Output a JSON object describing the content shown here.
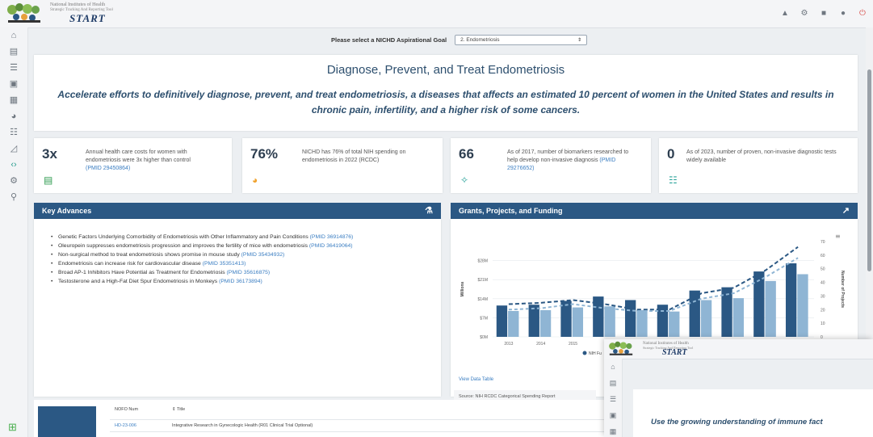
{
  "header": {
    "org_line1": "National Institutes of Health",
    "org_line2": "Strategic Tracking And Reporting Tool",
    "app_name": "START",
    "icons": [
      "megaphone-icon",
      "gear-icon",
      "chat-icon",
      "user-icon",
      "power-icon"
    ]
  },
  "sidebar": {
    "icons": [
      "home-icon",
      "document-icon",
      "list-icon",
      "briefcase-icon",
      "report-icon",
      "pie-chart-icon",
      "library-icon",
      "org-chart-icon",
      "code-icon",
      "settings-icon",
      "search-icon"
    ],
    "active": "code-icon"
  },
  "goal_selector": {
    "label": "Please select a NICHD Aspirational Goal",
    "selected": "2. Endometriosis"
  },
  "hero": {
    "title": "Diagnose, Prevent, and Treat Endometriosis",
    "text": "Accelerate efforts to definitively diagnose, prevent, and treat endometriosis, a diseases that affects an estimated 10 percent of women in the United States and results in chronic pain, infertility, and a higher risk of some cancers."
  },
  "stats": [
    {
      "value": "3x",
      "text": "Annual health care costs for women with endometriosis were 3x higher than control",
      "pmid": "(PMID 29450864)",
      "icon": "money-icon",
      "color": "#2e9b4f"
    },
    {
      "value": "76%",
      "text": "NICHD has 76% of total NIH spending on endometriosis in 2022 (RCDC)",
      "pmid": "",
      "icon": "pie-chart-icon",
      "color": "#f0a22e"
    },
    {
      "value": "66",
      "text": "As of 2017, number of biomarkers researched to help develop non-invasive diagnosis",
      "pmid": "(PMID 29276652)",
      "icon": "dna-icon",
      "color": "#2aa39a"
    },
    {
      "value": "0",
      "text": "As of 2023, number of proven, non-invasive diagnostic tests widely available",
      "pmid": "",
      "icon": "institution-icon",
      "color": "#2aa39a"
    }
  ],
  "key_advances": {
    "title": "Key Advances",
    "items": [
      {
        "text": "Genetic Factors Underlying Comorbidity of Endometriosis with Other Inflammatory and Pain Conditions ",
        "pmid": "(PMID 36914876)"
      },
      {
        "text": "Oleuropein suppresses endometriosis progression and improves the fertility of mice with endometriosis ",
        "pmid": "(PMID 36419064)"
      },
      {
        "text": "Non-surgical method to treat endometriosis shows promise in mouse study ",
        "pmid": "(PMID 35434932)"
      },
      {
        "text": "Endometriosis can increase risk for cardiovascular disease ",
        "pmid": "(PMID 35351413)"
      },
      {
        "text": "Broad AP-1 Inhibitors Have Potential as Treatment for Endometriosis ",
        "pmid": "(PMID 35616875)"
      },
      {
        "text": "Testosterone and a High-Fat Diet Spur Endometriosis in Monkeys ",
        "pmid": "(PMID 36173894)"
      }
    ]
  },
  "grants_panel": {
    "title": "Grants, Projects, and Funding",
    "view_table": "View Data Table",
    "source": "Source: NIH RCDC Categorical Spending Report",
    "legend_label": "NIH Fu"
  },
  "chart_data": {
    "type": "bar",
    "ylabel": "Millions",
    "y2label": "Number of Projects",
    "ylim": [
      0,
      35
    ],
    "y_ticks": [
      "$0M",
      "$7M",
      "$14M",
      "$21M",
      "$28M"
    ],
    "y2lim": [
      0,
      70
    ],
    "y2_ticks": [
      "0",
      "10",
      "20",
      "30",
      "40",
      "50",
      "60",
      "70"
    ],
    "x_ticks": [
      "2013",
      "2014",
      "2015"
    ],
    "series": [
      {
        "name": "NIH Fu",
        "type": "bar",
        "color": "#2b5884",
        "values": [
          11.5,
          11.8,
          13.2,
          14.8,
          13.5,
          11.8,
          17.0,
          18.2,
          24.0,
          27.0
        ]
      },
      {
        "name": "",
        "type": "bar",
        "color": "#8fb5d4",
        "values": [
          9.5,
          9.8,
          10.8,
          11.2,
          9.8,
          9.3,
          13.5,
          14.2,
          20.5,
          23.0
        ]
      },
      {
        "type": "line",
        "color": "#2b5884",
        "values": [
          24,
          25,
          27,
          24,
          20,
          20,
          32,
          36,
          49,
          66
        ]
      },
      {
        "type": "line",
        "color": "#8fb5d4",
        "values": [
          20,
          21,
          24,
          21,
          19,
          19,
          28,
          32,
          44,
          58
        ]
      }
    ]
  },
  "nofo": {
    "col1": "NOFO Num",
    "col2": "Title",
    "rows": [
      {
        "num": "HD-23-006",
        "title": "Integrative Research in Gynecologic Health (R01 Clinical Trial Optional)"
      }
    ]
  },
  "mini_window": {
    "org_line1": "National Institutes of Health",
    "org_line2": "Strategic Tracking And Reporting Tool",
    "app_name": "START",
    "text": "Use the growing understanding of immune fact"
  }
}
